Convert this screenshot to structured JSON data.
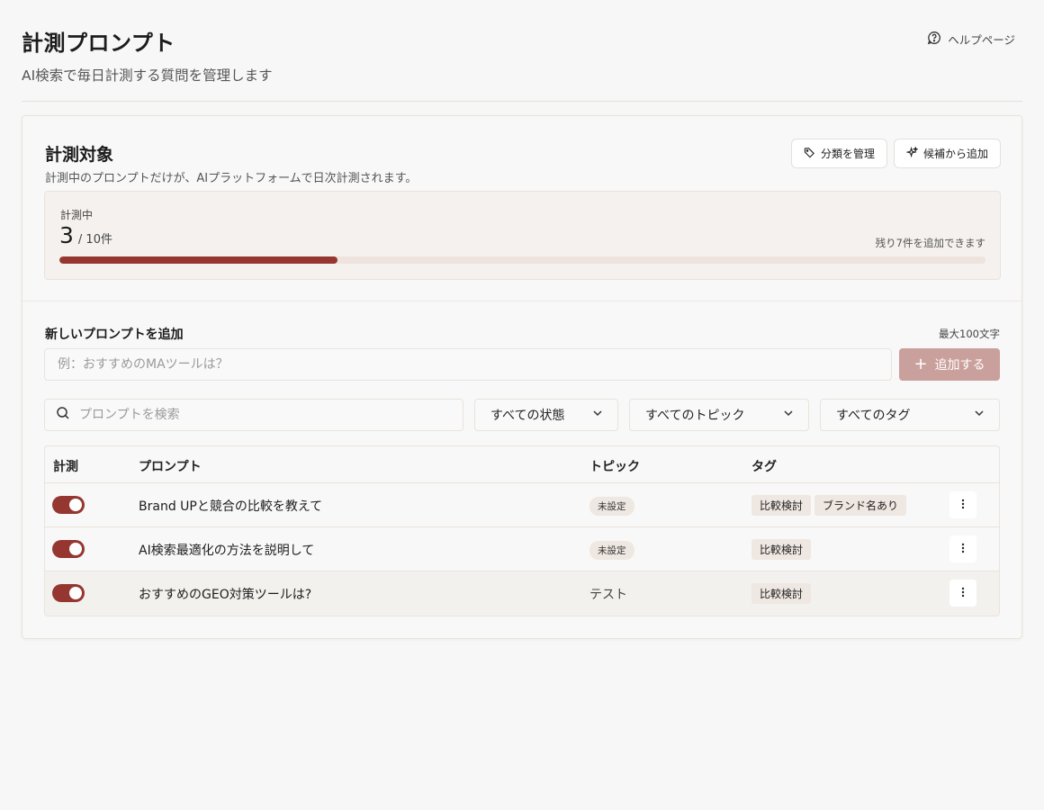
{
  "header": {
    "title": "計測プロンプト",
    "subtitle": "AI検索で毎日計測する質問を管理します",
    "help_label": "ヘルプページ"
  },
  "section": {
    "title": "計測対象",
    "description": "計測中のプロンプトだけが、AIプラットフォームで日次計測されます。",
    "manage_button": "分類を管理",
    "candidates_button": "候補から追加"
  },
  "quota": {
    "label": "計測中",
    "current": "3",
    "total": "/ 10件",
    "remaining": "残り7件を追加できます",
    "progress_fraction": 0.3
  },
  "add_prompt": {
    "title": "新しいプロンプトを追加",
    "max_label": "最大100文字",
    "placeholder": "例：おすすめのMAツールは？",
    "button_label": "追加する"
  },
  "filters": {
    "search_placeholder": "プロンプトを検索",
    "status": "すべての状態",
    "topic": "すべてのトピック",
    "tag": "すべてのタグ"
  },
  "table": {
    "columns": {
      "measure": "計測",
      "prompt": "プロンプト",
      "topic": "トピック",
      "tags": "タグ"
    },
    "rows": [
      {
        "enabled": true,
        "prompt": "Brand UPと競合の比較を教えて",
        "topic": "未設定",
        "topic_unset": true,
        "tags": [
          "比較検討",
          "ブランド名あり"
        ]
      },
      {
        "enabled": true,
        "prompt": "AI検索最適化の方法を説明して",
        "topic": "未設定",
        "topic_unset": true,
        "tags": [
          "比較検討"
        ]
      },
      {
        "enabled": true,
        "prompt": "おすすめのGEO対策ツールは?",
        "topic": "テスト",
        "topic_unset": false,
        "tags": [
          "比較検討"
        ]
      }
    ]
  },
  "colors": {
    "accent": "#953730",
    "accent_disabled": "#caa09d",
    "badge_bg": "#efe7e2",
    "background": "#f6f7f6"
  },
  "icons": {
    "help": "help-circle-icon",
    "tag": "tag-icon",
    "sparkle": "sparkle-icon",
    "search": "search-icon",
    "chevron": "chevron-down-icon",
    "menu": "more-vertical-icon",
    "plus": "plus-icon"
  }
}
